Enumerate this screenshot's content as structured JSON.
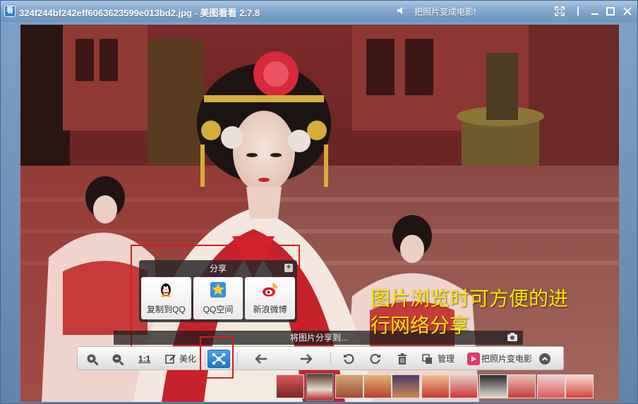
{
  "window": {
    "app_icon_char": "看",
    "title": "324f244bf242eff6063623599e013bd2.jpg - 美图看看 2.7.8",
    "promo_text": "把照片变成电影!"
  },
  "share_popup": {
    "header": "分享",
    "plus": "+",
    "items": [
      {
        "label": "复制到QQ",
        "icon": "qq-penguin-icon"
      },
      {
        "label": "QQ空间",
        "icon": "qzone-star-icon"
      },
      {
        "label": "新浪微博",
        "icon": "weibo-icon"
      }
    ],
    "status_text": "将图片分享到..."
  },
  "caption": {
    "line1": "图片浏览时可方便的进",
    "line2": "行网络分享"
  },
  "toolbar": {
    "ratio_label": "1:1",
    "beautify_label": "美化",
    "manage_label": "管理",
    "movie_label": "把照片变电影"
  },
  "colors": {
    "accent": "#1e77c9",
    "annotation": "#d81b1b",
    "caption": "#ffe600"
  },
  "thumbnails_count": 11,
  "selected_thumbnail_index": 1
}
